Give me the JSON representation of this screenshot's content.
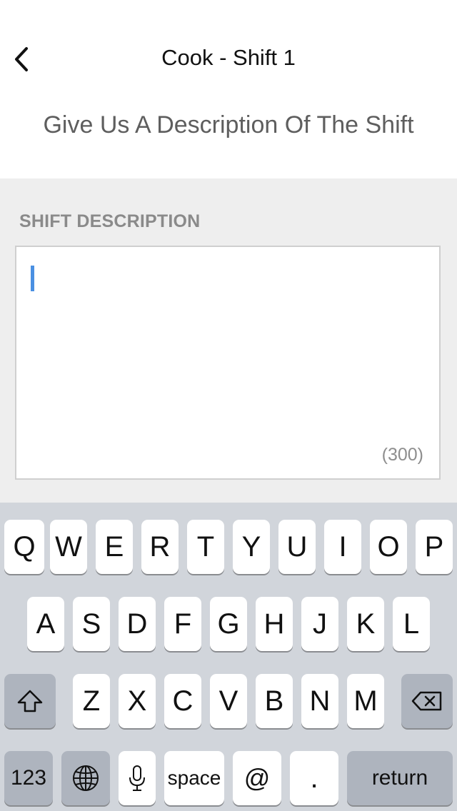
{
  "nav": {
    "title": "Cook - Shift 1",
    "back_icon": "chevron-left-icon"
  },
  "subtitle": "Give Us A Description Of The Shift",
  "field": {
    "label": "SHIFT DESCRIPTION",
    "value": "",
    "counter": "(300)"
  },
  "keyboard": {
    "row1": [
      "Q",
      "W",
      "E",
      "R",
      "T",
      "Y",
      "U",
      "I",
      "O",
      "P"
    ],
    "row2": [
      "A",
      "S",
      "D",
      "F",
      "G",
      "H",
      "J",
      "K",
      "L"
    ],
    "row3": [
      "Z",
      "X",
      "C",
      "V",
      "B",
      "N",
      "M"
    ],
    "numbers_label": "123",
    "space_label": "space",
    "at_label": "@",
    "dot_label": ".",
    "return_label": "return",
    "icons": [
      "shift-icon",
      "backspace-icon",
      "globe-icon",
      "microphone-icon"
    ]
  }
}
